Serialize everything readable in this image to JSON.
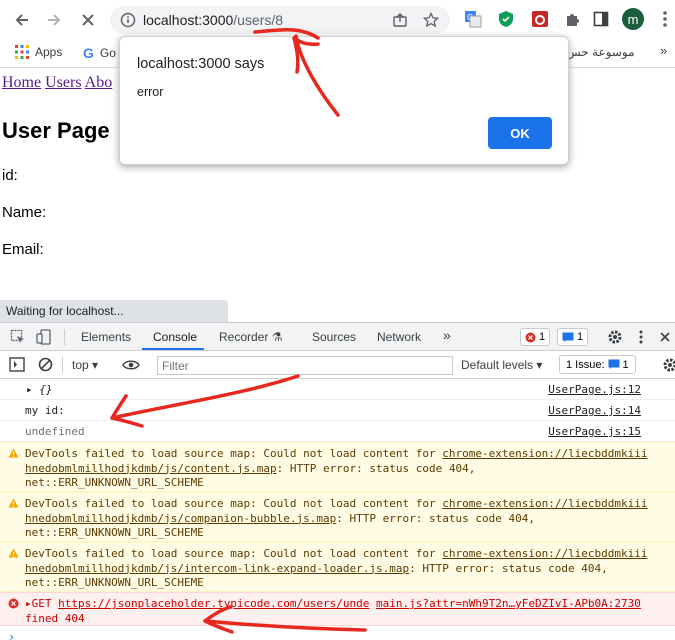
{
  "browser": {
    "url_host": "localhost:3000",
    "url_path": "/users/8",
    "avatar_letter": "m",
    "bookmarks": {
      "apps_label": "Apps",
      "google_label": "Go",
      "rtl_label": "موسوعة حس"
    }
  },
  "page": {
    "nav": {
      "home": "Home",
      "users": "Users",
      "about": "Abo"
    },
    "title": "User Page",
    "fields": {
      "id_label": "id:",
      "name_label": "Name:",
      "email_label": "Email:"
    },
    "status": "Waiting for localhost..."
  },
  "dialog": {
    "title": "localhost:3000 says",
    "message": "error",
    "ok_label": "OK"
  },
  "devtools": {
    "tabs": [
      "Elements",
      "Console",
      "Recorder",
      "Sources",
      "Network"
    ],
    "more_tabs": "»",
    "error_count": "1",
    "message_count": "1",
    "context": "top",
    "filter_placeholder": "Filter",
    "levels": "Default levels",
    "issues_label": "1 Issue:",
    "issues_count": "1",
    "messages": [
      {
        "text": "{}",
        "source": "UserPage.js:12"
      },
      {
        "text": "my id:",
        "source": "UserPage.js:14"
      },
      {
        "text": "undefined",
        "source": "UserPage.js:15"
      }
    ],
    "warnings": [
      {
        "l1_pre": "DevTools failed to load source map: Could not load content for ",
        "l1_link": "chrome-extension://liecbddmkiii",
        "l2_link": "hnedobmlmillhodjkdmb/js/content.js.map",
        "l2_post": ": HTTP error: status code 404,",
        "l3": "net::ERR_UNKNOWN_URL_SCHEME"
      },
      {
        "l1_pre": "DevTools failed to load source map: Could not load content for ",
        "l1_link": "chrome-extension://liecbddmkiii",
        "l2_link": "hnedobmlmillhodjkdmb/js/companion-bubble.js.map",
        "l2_post": ": HTTP error: status code 404,",
        "l3": "net::ERR_UNKNOWN_URL_SCHEME"
      },
      {
        "l1_pre": "DevTools failed to load source map: Could not load content for ",
        "l1_link": "chrome-extension://liecbddmkiii",
        "l2_link": "hnedobmlmillhodjkdmb/js/intercom-link-expand-loader.js.map",
        "l2_post": ": HTTP error: status code 404,",
        "l3": "net::ERR_UNKNOWN_URL_SCHEME"
      }
    ],
    "error": {
      "method": "GET",
      "url": "https://jsonplaceholder.typicode.com/users/unde",
      "source": "main.js?attr=nWh9T2n…yFeDZIvI-APb0A:2730",
      "l2": "fined",
      "status": "404"
    }
  },
  "colors": {
    "accent_blue": "#1a73e8",
    "link_purple": "#551a8b",
    "annotation_red": "#e8281f",
    "warning_bg": "#fffbe5",
    "error_bg": "#fff0f0"
  }
}
